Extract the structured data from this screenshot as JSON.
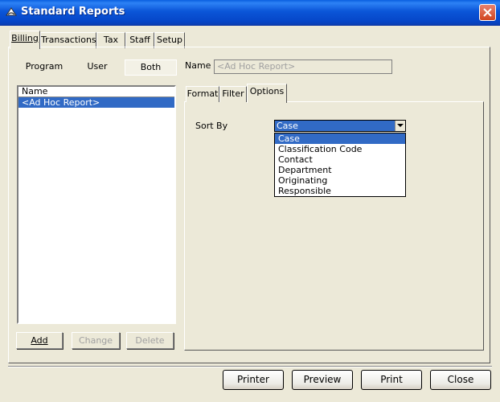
{
  "window": {
    "title": "Standard Reports",
    "icon": "report-app-icon"
  },
  "top_tabs": [
    {
      "label": "Billing",
      "active": true
    },
    {
      "label": "Transactions",
      "active": false
    },
    {
      "label": "Tax",
      "active": false
    },
    {
      "label": "Staff",
      "active": false
    },
    {
      "label": "Setup",
      "active": false
    }
  ],
  "report_modes": {
    "program": "Program",
    "user": "User",
    "both": "Both",
    "selected": "Both"
  },
  "name_field": {
    "label": "Name",
    "value": "<Ad Hoc Report>"
  },
  "report_list": {
    "header": "Name",
    "items": [
      "<Ad Hoc Report>"
    ],
    "selected_index": 0
  },
  "list_buttons": {
    "add": "Add",
    "change": "Change",
    "delete": "Delete"
  },
  "sub_tabs": [
    {
      "label": "Format",
      "active": false
    },
    {
      "label": "Filter",
      "active": false
    },
    {
      "label": "Options",
      "active": true
    }
  ],
  "options": {
    "sort_by_label": "Sort By",
    "sort_by_value": "Case",
    "sort_by_options": [
      "Case",
      "Classification Code",
      "Contact",
      "Department",
      "Originating",
      "Responsible"
    ],
    "highlighted": "Case"
  },
  "footer_buttons": {
    "printer": "Printer",
    "preview": "Preview",
    "print": "Print",
    "close": "Close"
  },
  "colors": {
    "titlebar": "#0a5fe0",
    "selection": "#316ac5",
    "window_bg": "#ece9d8",
    "close_button": "#d14520"
  }
}
